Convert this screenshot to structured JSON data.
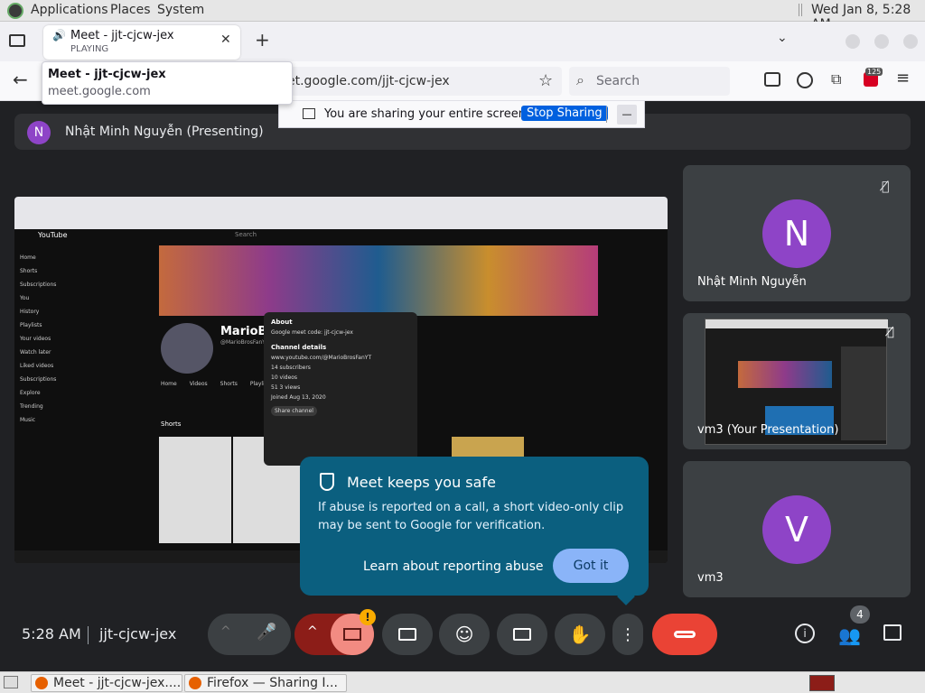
{
  "top_panel": {
    "applications": "Applications",
    "places": "Places",
    "system": "System",
    "clock": "Wed Jan  8,  5:28 AM"
  },
  "browser": {
    "tab": {
      "title": "Meet - jjt-cjcw-jex",
      "status": "PLAYING"
    },
    "tooltip": {
      "title": "Meet - jjt-cjcw-jex",
      "url": "meet.google.com"
    },
    "url_visible": "et.google.com/jjt-cjcw-jex",
    "search_placeholder": "Search",
    "extension_badge": "125"
  },
  "share_bar": {
    "message": "You are sharing your entire screen.",
    "stop_button": "Stop Sharing",
    "minimize": "—"
  },
  "presenter": {
    "initial": "N",
    "label": "Nhật Minh Nguyễn (Presenting)"
  },
  "shared_screen": {
    "youtube_logo": "YouTube",
    "search": "Search",
    "sidebar": [
      "Home",
      "Shorts",
      "Subscriptions",
      "You",
      "History",
      "Playlists",
      "Your videos",
      "Watch later",
      "Liked videos",
      "Subscriptions",
      "Explore",
      "Trending",
      "Music"
    ],
    "channel_name": "MarioBr",
    "channel_handle": "@MarioBrosFanYT",
    "tabs": [
      "Home",
      "Videos",
      "Shorts",
      "Playlists"
    ],
    "shorts_label": "Shorts",
    "about_title": "About",
    "about_desc": "Google meet code: jjt-cjcw-jex",
    "channel_details_title": "Channel details",
    "details": [
      "www.youtube.com/@MarioBrosFanYT",
      "14 subscribers",
      "10 videos",
      "51 3 views",
      "Joined Aug 13, 2020"
    ],
    "share_channel": "Share channel"
  },
  "tiles": [
    {
      "initial": "N",
      "name": "Nhật Minh Nguyễn",
      "color": "#8e44c7"
    },
    {
      "name": "vm3 (Your Presentation)"
    },
    {
      "initial": "V",
      "name": "vm3",
      "color": "#8e44c7"
    }
  ],
  "popup": {
    "title": "Meet keeps you safe",
    "body": "If abuse is reported on a call, a short video-only clip may be sent to Google for verification.",
    "learn_link": "Learn about reporting abuse",
    "got_it": "Got it"
  },
  "meeting": {
    "time": "5:28 AM",
    "code": "jjt-cjcw-jex",
    "people_count": "4"
  },
  "taskbar": {
    "tasks": [
      "Meet - jjt-cjcw-jex....",
      "Firefox — Sharing I..."
    ]
  },
  "colors": {
    "accent": "#8ab4f8",
    "hangup": "#ea4335",
    "camera_off": "#f28b82",
    "popup_bg": "#0b5f7f"
  }
}
